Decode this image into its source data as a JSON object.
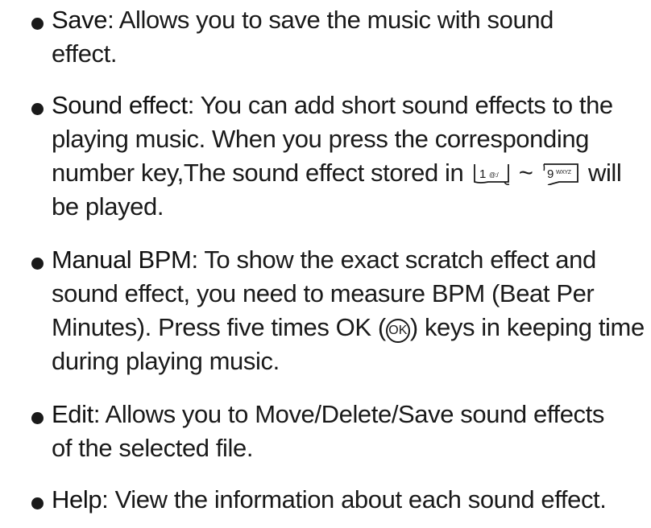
{
  "items": [
    {
      "term": "Save",
      "text": ": Allows you to save the music with sound effect."
    },
    {
      "term": "Sound effect",
      "text_before_keys": ": You can add short sound effects to the playing music. When you press the corresponding number key,The sound effect stored in",
      "key_first": {
        "digit": "1",
        "sub": "@:/",
        "icon": "key-1-icon"
      },
      "key_separator": "~",
      "key_last": {
        "digit": "9",
        "sub": "WXYZ",
        "icon": "key-9-icon"
      },
      "text_after_keys": "will be played."
    },
    {
      "term": "Manual BPM",
      "text_before_key": ": To show the exact scratch effect and sound effect, you need to measure BPM (Beat Per Minutes). Press five times OK (",
      "ok_key": {
        "label": "OK",
        "icon": "ok-key-icon"
      },
      "text_after_key": ") keys in keeping time during playing music."
    },
    {
      "term": "Edit",
      "text": ": Allows you to Move/Delete/Save sound effects of the selected file."
    },
    {
      "term": "Help",
      "text": ": View the information about each sound effect."
    }
  ]
}
